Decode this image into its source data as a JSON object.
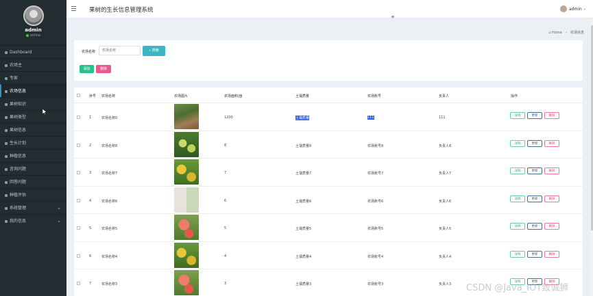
{
  "sidebar": {
    "user_name": "admin",
    "user_status": "online",
    "items": [
      {
        "label": "Dashboard",
        "icon": "dashboard-icon"
      },
      {
        "label": "农场主",
        "icon": "user-icon"
      },
      {
        "label": "专家",
        "icon": "user-icon"
      },
      {
        "label": "农场信息",
        "icon": "list-icon",
        "active": true
      },
      {
        "label": "果树知识",
        "icon": "list-icon"
      },
      {
        "label": "果树类型",
        "icon": "list-icon"
      },
      {
        "label": "果树信息",
        "icon": "list-icon"
      },
      {
        "label": "生长计划",
        "icon": "list-icon"
      },
      {
        "label": "种植信息",
        "icon": "list-icon"
      },
      {
        "label": "咨询问题",
        "icon": "list-icon"
      },
      {
        "label": "回答问题",
        "icon": "list-icon"
      },
      {
        "label": "种植评估",
        "icon": "list-icon"
      },
      {
        "label": "系统管理",
        "icon": "gear-icon",
        "expandable": true
      },
      {
        "label": "我的信息",
        "icon": "user-icon",
        "expandable": true
      }
    ]
  },
  "header": {
    "title": "果树的生长信息管理系统",
    "user": "admin"
  },
  "breadcrumb": {
    "home": "Home",
    "current": "农场信息"
  },
  "search": {
    "label": "农场名称",
    "placeholder": "农场名称",
    "button": "搜索",
    "add_button": "添加",
    "delete_button": "删除"
  },
  "table": {
    "columns": [
      "序号",
      "农场名称",
      "农场图片",
      "农场面积/亩",
      "土壤质量",
      "农场账号",
      "负责人",
      "操作"
    ],
    "ops": {
      "view": "详情",
      "edit": "更新",
      "delete": "删除"
    },
    "rows": [
      {
        "no": "1",
        "name": "农场名称0",
        "area": "1200",
        "soil": "土壤质量",
        "account": "111",
        "owner": "111",
        "img": "tree-photo",
        "highlight": true
      },
      {
        "no": "2",
        "name": "农场名称8",
        "area": "8",
        "soil": "土壤质量8",
        "account": "农场账号8",
        "owner": "负责人8",
        "img": "fruit-photo-green"
      },
      {
        "no": "3",
        "name": "农场名称7",
        "area": "7",
        "soil": "土壤质量7",
        "account": "农场账号7",
        "owner": "负责人7",
        "img": "fruit-photo-yellow"
      },
      {
        "no": "4",
        "name": "农场名称6",
        "area": "6",
        "soil": "土壤质量6",
        "account": "农场账号6",
        "owner": "负责人6",
        "img": "fruit-collage"
      },
      {
        "no": "5",
        "name": "农场名称5",
        "area": "5",
        "soil": "土壤质量5",
        "account": "农场账号5",
        "owner": "负责人5",
        "img": "fruit-photo-red"
      },
      {
        "no": "6",
        "name": "农场名称4",
        "area": "4",
        "soil": "土壤质量4",
        "account": "农场账号4",
        "owner": "负责人4",
        "img": "fruit-photo-yellow"
      },
      {
        "no": "7",
        "name": "农场名称3",
        "area": "3",
        "soil": "土壤质量3",
        "account": "农场账号3",
        "owner": "负责人3",
        "img": "fruit-photo-red"
      }
    ]
  },
  "watermark": "CSDN @Java_IOT致诚狮"
}
